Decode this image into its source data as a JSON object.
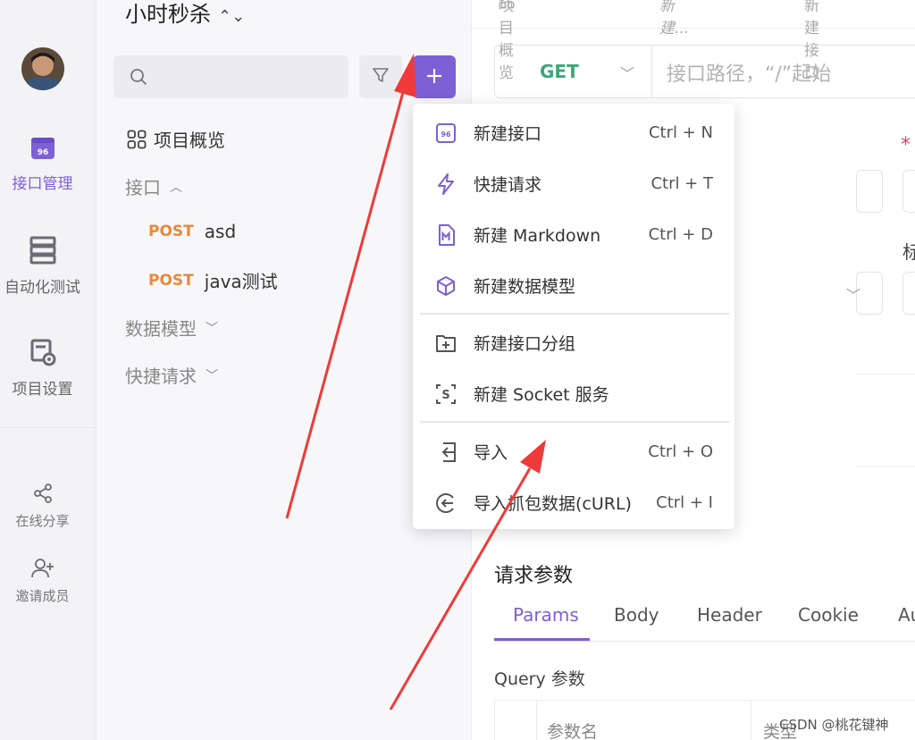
{
  "sidebar": {
    "items": [
      {
        "label": "接口管理",
        "icon": "api-icon"
      },
      {
        "label": "自动化测试",
        "icon": "server-icon"
      },
      {
        "label": "项目设置",
        "icon": "settings-server-icon"
      }
    ],
    "bottom_items": [
      {
        "label": "在线分享",
        "icon": "share-icon"
      },
      {
        "label": "邀请成员",
        "icon": "add-user-icon"
      }
    ]
  },
  "project": {
    "title": "小时秒杀",
    "overview_label": "项目概览",
    "tree": [
      {
        "label": "接口"
      },
      {
        "method": "POST",
        "label": "asd"
      },
      {
        "method": "POST",
        "label": "java测试"
      },
      {
        "label": "数据模型"
      },
      {
        "label": "快捷请求"
      }
    ]
  },
  "main": {
    "tabs": [
      "项目概览",
      "新建...",
      "新建接口"
    ],
    "method": "GET",
    "url_placeholder": "接口路径，“/”起始",
    "required_mark": "*",
    "partial_label": "标",
    "request_params_title": "请求参数",
    "request_tabs": [
      "Params",
      "Body",
      "Header",
      "Cookie",
      "Au"
    ],
    "query_label": "Query 参数",
    "table_headers": [
      "参数名",
      "类型"
    ]
  },
  "menu": {
    "items": [
      {
        "label": "新建接口",
        "shortcut": "Ctrl + N",
        "icon": "api-icon"
      },
      {
        "label": "快捷请求",
        "shortcut": "Ctrl + T",
        "icon": "lightning-icon"
      },
      {
        "label": "新建 Markdown",
        "shortcut": "Ctrl + D",
        "icon": "markdown-icon"
      },
      {
        "label": "新建数据模型",
        "shortcut": "",
        "icon": "cube-icon"
      },
      {
        "label": "新建接口分组",
        "shortcut": "",
        "icon": "folder-plus-icon"
      },
      {
        "label": "新建 Socket 服务",
        "shortcut": "",
        "icon": "socket-icon"
      },
      {
        "label": "导入",
        "shortcut": "Ctrl + O",
        "icon": "import-icon"
      },
      {
        "label": "导入抓包数据(cURL)",
        "shortcut": "Ctrl + I",
        "icon": "curl-import-icon"
      }
    ]
  },
  "colors": {
    "accent": "#7d5fd6",
    "post": "#e8893a",
    "get": "#3aa876",
    "annotation": "#ee3a3a"
  },
  "watermark": "CSDN @桃花键神"
}
